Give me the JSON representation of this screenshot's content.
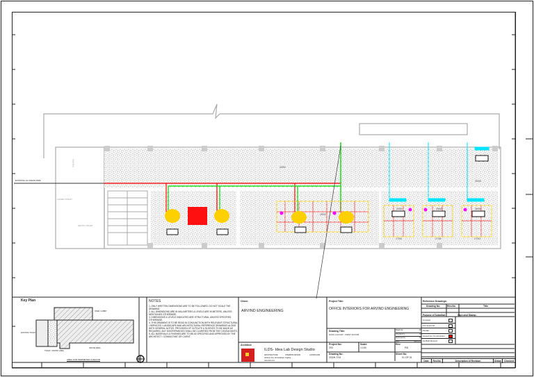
{
  "colors": {
    "supply": "#ff2020",
    "return": "#22dd22",
    "drain": "#00e5ff",
    "unit": "#ffd000",
    "diffuser": "#ff00ff",
    "accent": "#e02020"
  },
  "plan": {
    "room_labels": [
      "2850",
      "2850",
      "2850",
      "2850",
      "2750",
      "2750",
      "2750",
      "2850",
      "2850"
    ],
    "left_labels": [
      "LADIES TOILET",
      "GENTS TOILET",
      "PANTRY"
    ],
    "annotation": "EXISTING AC DRAIN PIPE"
  },
  "key_plan": {
    "title": "Key Plan",
    "caption": "AREA FOR PERIMETER & DECOR",
    "labels": [
      "STAIR / LOBBY",
      "EXISTING TOILET",
      "TOILET / PANTRY AREA",
      "OFFICE AREA"
    ]
  },
  "notes": {
    "title": "NOTES",
    "items": [
      "1. ONLY WRITTEN DIMENSIONS ARE TO BE FOLLOWED. DO NOT SCALE THE DRAWING.",
      "2. ALL DIMENSIONS ARE IN MILLIMETERS & LEVELS ARE IN METERS, UNLESS MENTIONED OTHERWISE.",
      "3. DIMENSIONS & LEVELS INDICATED ARE STRUCTURAL UNLESS SPECIFIED OTHERWISE.",
      "4. THIS DRAWING IS TO BE READ IN CONJUNCTION WITH RELEVANT STRUCTURAL / SERVICES / LANDSCAPE AND ARCHITECTURAL REFERENCE DRAWINGS ALONG WITH GENERAL NOTES. PROVISION OF CUTOUTS & SLEEVES TO BE MADE AS REQUIRED. ANY DISCREPANCIES SHALL BE CLARIFIED FROM THE CONSULTANTS.",
      "5. ALL MATERIALS & FINISHES ARE TO BE AS SPECIFIED AND APPROVED BY THE ARCHITECT / CONSULTANT OR CLIENT."
    ]
  },
  "client": {
    "label": "Client:",
    "name": "ARVIND ENGINEERING"
  },
  "architect": {
    "label": "Architect:",
    "firm": "ILDS- Idea Lab Design Studio",
    "services": [
      "ARCHITECTURE",
      "INTERIOR DESIGN",
      "LANDSCAPE"
    ],
    "address": "Address line, Ahmedabad, Gujarat",
    "contact": "www.ilds.com"
  },
  "project": {
    "title_label": "Project Title:",
    "title": "OFFICE INTERIORS FOR ARVIND ENGINEERING",
    "drawing_title_label": "Drawing Title:",
    "drawing_title": "HVAC LAYOUT - FIRST FLOOR",
    "signoffs": [
      {
        "role": "Drawn by",
        "val": "AK"
      },
      {
        "role": "Checked by",
        "val": "AK"
      },
      {
        "role": "Approved by",
        "val": "AK"
      },
      {
        "role": "Date",
        "val": "dd/mm/yy"
      }
    ],
    "project_no_label": "Project No:",
    "project_no": "203",
    "scale_label": "Scale:",
    "scale": "1:100",
    "rev_label": "Rev:",
    "rev": "R0",
    "drawing_no_label": "Drawing No:",
    "drawing_no": "203/H-T/01",
    "sheet_no_label": "Sheet No:",
    "sheet_no": "01 OF 01"
  },
  "reference": {
    "label": "Reference Drawings:",
    "cols": [
      "Drawing No.",
      "Rev.No.",
      "Title"
    ]
  },
  "purpose": {
    "label": "Purpose of Submittal:",
    "items": [
      {
        "label": "Concept",
        "checked": false
      },
      {
        "label": "For Approval",
        "checked": false
      },
      {
        "label": "Tender",
        "checked": false
      },
      {
        "label": "Issued For Construction",
        "checked": true
      },
      {
        "label": "As Built Record",
        "checked": false
      }
    ],
    "sign_label": "Sign and Stamp:"
  },
  "revisions": {
    "cols": [
      "Date",
      "Rev.No.",
      "Description of Revision",
      "Drawn",
      "Checked"
    ]
  }
}
